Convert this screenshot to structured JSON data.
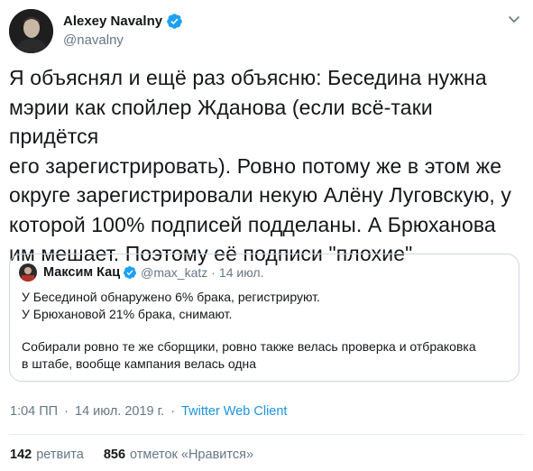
{
  "author": {
    "name": "Alexey Navalny",
    "handle": "@navalny",
    "verified_color": "#1da1f2"
  },
  "tweet": {
    "text": "Я объяснял и ещё раз объясню: Беседина нужна\nмэрии как спойлер Жданова (если всё-таки придётся\nего зарегистрировать). Ровно потому же в этом же\nокруге зарегистрировали некую Алёну Луговскую, у\nкоторой 100% подписей подделаны. А Брюханова\nим мешает. Поэтому её подписи \"плохие\""
  },
  "quote": {
    "name": "Максим Кац",
    "handle": "@max_katz",
    "dot": "·",
    "date": "14 июл.",
    "lines": [
      "У Бесединой обнаружено 6% брака, регистрируют.",
      "У Брюхановой 21% брака, снимают."
    ],
    "paragraph2": [
      "Собирали ровно те же сборщики, ровно также велась проверка и отбраковка",
      "в штабе, вообще кампания велась одна"
    ]
  },
  "meta": {
    "time": "1:04 ПП",
    "dot": "·",
    "date": "14 июл. 2019 г.",
    "source": "Twitter Web Client"
  },
  "stats": {
    "retweets_count": "142",
    "retweets_label": "ретвита",
    "likes_count": "856",
    "likes_label": "отметок «Нравится»"
  },
  "colors": {
    "accent": "#1b95e0",
    "secondary_text": "#657786",
    "border": "#ccd6dd"
  }
}
